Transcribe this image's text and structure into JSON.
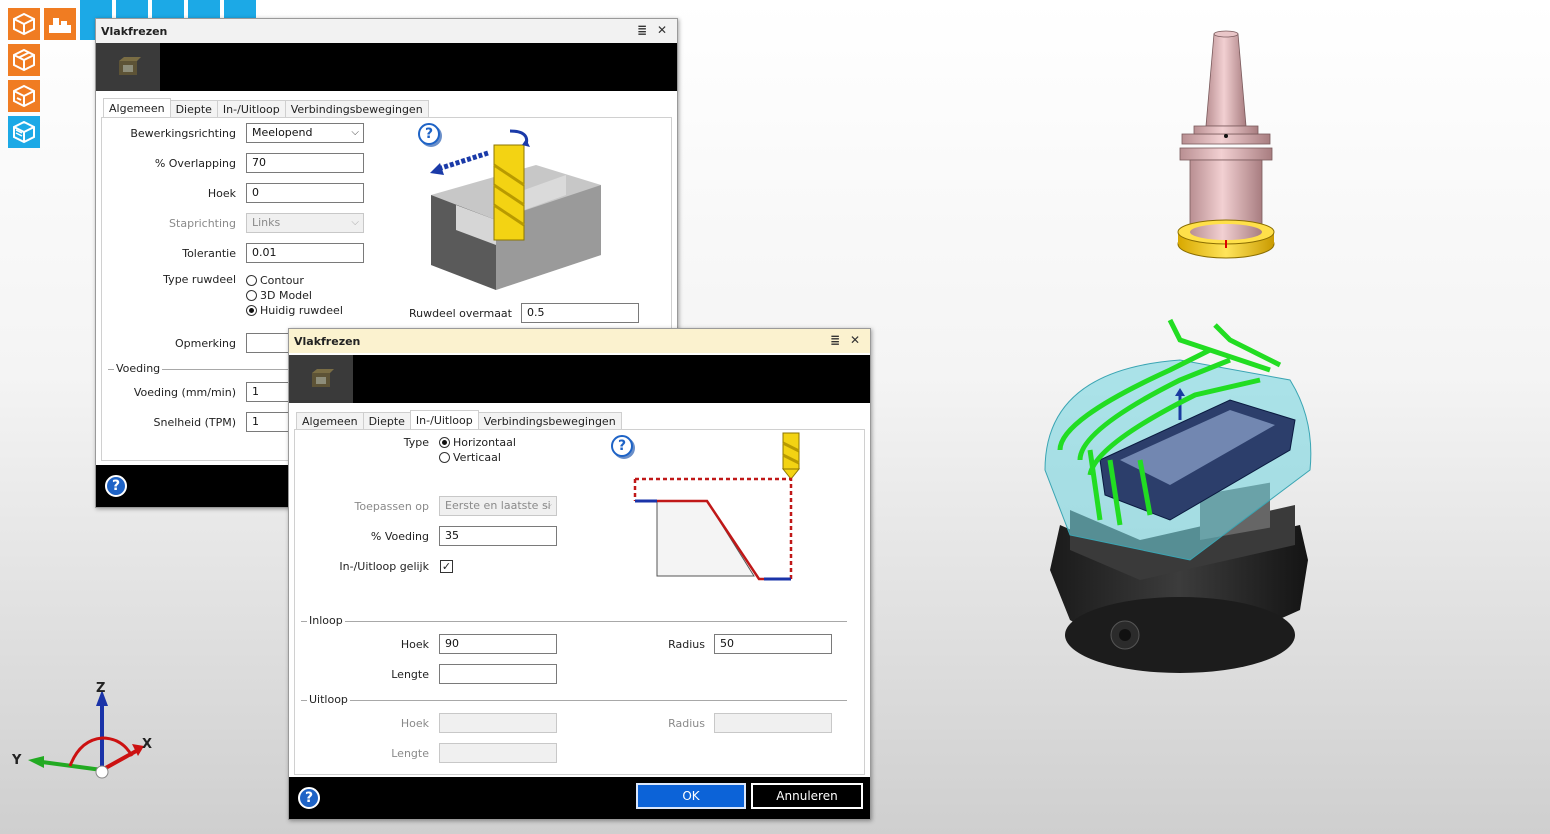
{
  "toolbar": {
    "icons": [
      "box-icon",
      "machine-icon",
      "stock-box-icon",
      "stock-box-icon",
      "layers-box-icon"
    ]
  },
  "dialog1": {
    "title": "Vlakfrezen",
    "tabs": [
      "Algemeen",
      "Diepte",
      "In-/Uitloop",
      "Verbindingsbewegingen"
    ],
    "active_tab": 0,
    "fields": {
      "bewerkingsrichting_label": "Bewerkingsrichting",
      "bewerkingsrichting_value": "Meelopend",
      "overlapping_label": "% Overlapping",
      "overlapping_value": "70",
      "hoek_label": "Hoek",
      "hoek_value": "0",
      "staprichting_label": "Staprichting",
      "staprichting_value": "Links",
      "tolerantie_label": "Tolerantie",
      "tolerantie_value": "0.01",
      "type_ruwdeel_label": "Type ruwdeel",
      "type_ruwdeel_options": [
        "Contour",
        "3D Model",
        "Huidig ruwdeel"
      ],
      "type_ruwdeel_selected": 2,
      "ruwdeel_overmaat_label": "Ruwdeel overmaat",
      "ruwdeel_overmaat_value": "0.5",
      "opmerking_label": "Opmerking",
      "voeding_group": "Voeding",
      "voeding_label": "Voeding (mm/min)",
      "voeding_value": "1",
      "snelheid_label": "Snelheid (TPM)",
      "snelheid_value": "1"
    }
  },
  "dialog2": {
    "title": "Vlakfrezen",
    "tabs": [
      "Algemeen",
      "Diepte",
      "In-/Uitloop",
      "Verbindingsbewegingen"
    ],
    "active_tab": 2,
    "fields": {
      "type_label": "Type",
      "type_options": [
        "Horizontaal",
        "Verticaal"
      ],
      "type_selected": 0,
      "toepassen_label": "Toepassen op",
      "toepassen_value": "Eerste en laatste si",
      "voeding_label": "% Voeding",
      "voeding_value": "35",
      "gelijk_label": "In-/Uitloop gelijk",
      "gelijk_checked": true,
      "inloop_group": "Inloop",
      "inloop_hoek_label": "Hoek",
      "inloop_hoek_value": "90",
      "inloop_radius_label": "Radius",
      "inloop_radius_value": "50",
      "inloop_lengte_label": "Lengte",
      "inloop_lengte_value": "",
      "uitloop_group": "Uitloop",
      "uitloop_hoek_label": "Hoek",
      "uitloop_radius_label": "Radius",
      "uitloop_lengte_label": "Lengte"
    },
    "ok_label": "OK",
    "cancel_label": "Annuleren"
  },
  "axis": {
    "x": "X",
    "y": "Y",
    "z": "Z"
  },
  "help_glyph": "?",
  "colors": {
    "accent_orange": "#f07c22",
    "accent_cyan": "#1ca9e6",
    "titlebar_active": "#fbf2cf",
    "primary_button": "#0c63d8",
    "toolpath_green": "#22dd22"
  }
}
